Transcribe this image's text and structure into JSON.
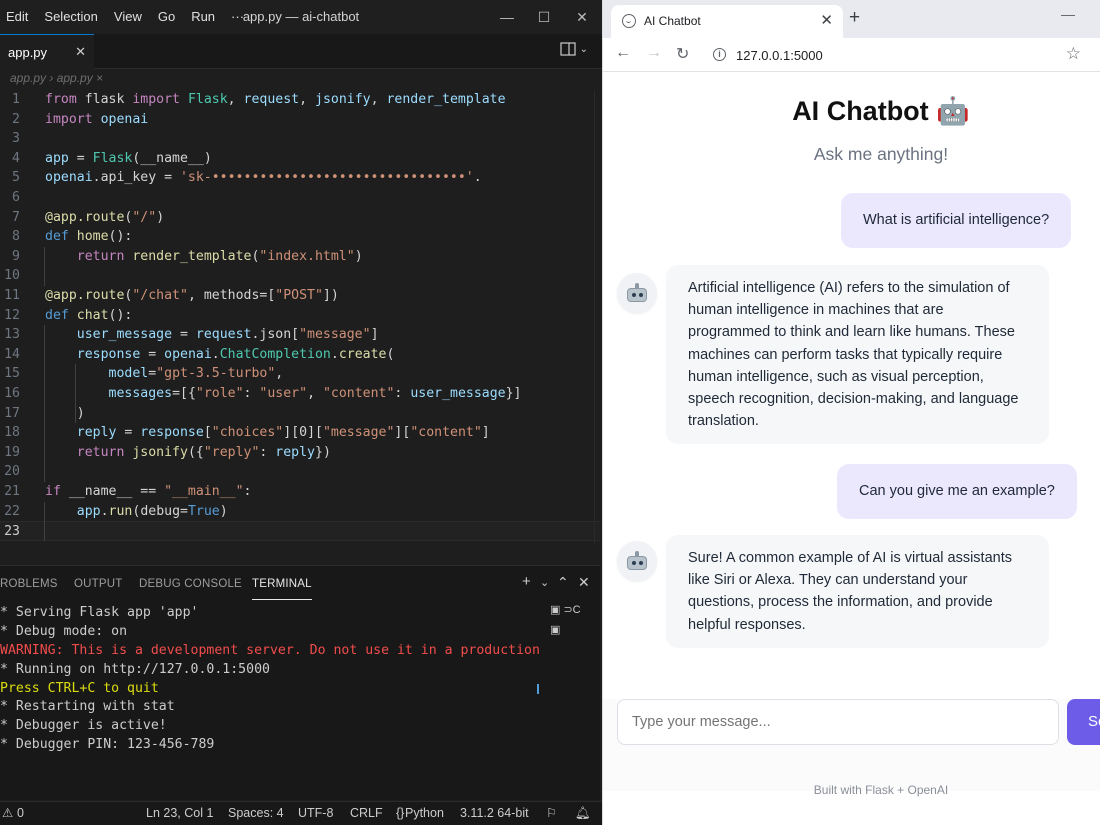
{
  "vscode": {
    "menu": [
      "Edit",
      "Selection",
      "View",
      "Go",
      "Run",
      "···"
    ],
    "window_title": "app.py — ai-chatbot",
    "tab": {
      "label": "app.py"
    },
    "breadcrumb": "app.py › app.py ×",
    "current_line": 23,
    "code_lines": [
      "from flask import Flask, request, jsonify, render_template",
      "import openai",
      "",
      "app = Flask(__name__)",
      "openai.api_key = 'sk-••••••••••••••••••••••••••••••••'.",
      "",
      "@app.route(\"/\")",
      "def home():",
      "    return render_template(\"index.html\")",
      "",
      "@app.route(\"/chat\", methods=[\"POST\"])",
      "def chat():",
      "    user_message = request.json[\"message\"]",
      "    response = openai.ChatCompletion.create(",
      "        model=\"gpt-3.5-turbo\",",
      "        messages=[{\"role\": \"user\", \"content\": user_message}]",
      "    )",
      "    reply = response[\"choices\"][0][\"message\"][\"content\"]",
      "    return jsonify({\"reply\": reply})",
      "",
      "if __name__ == \"__main__\":",
      "    app.run(debug=True)",
      ""
    ],
    "panel_tabs": [
      "PROBLEMS",
      "OUTPUT",
      "DEBUG CONSOLE",
      "TERMINAL"
    ],
    "active_panel_tab": "TERMINAL",
    "terminal_lines": [
      {
        "text": "* Serving Flask app 'app'",
        "kind": "normal"
      },
      {
        "text": "* Debug mode: on",
        "kind": "normal"
      },
      {
        "text": "WARNING: This is a development server. Do not use it in a production",
        "kind": "warn"
      },
      {
        "text": "* Running on http://127.0.0.1:5000",
        "kind": "normal"
      },
      {
        "text": "Press CTRL+C to quit",
        "kind": "yellow"
      },
      {
        "text": "* Restarting with stat",
        "kind": "normal"
      },
      {
        "text": "* Debugger is active!",
        "kind": "normal"
      },
      {
        "text": "* Debugger PIN: 123-456-789",
        "kind": "normal"
      }
    ],
    "status": {
      "errors": "0",
      "position": "Ln 23, Col 1",
      "spaces": "Spaces: 4",
      "encoding": "UTF-8",
      "eol": "CRLF",
      "language": "Python",
      "interpreter": "3.11.2 64-bit"
    }
  },
  "browser": {
    "tab_title": "AI Chatbot",
    "url": "127.0.0.1:5000",
    "page": {
      "title": "AI Chatbot 🤖",
      "subtitle": "Ask me anything!",
      "messages": [
        {
          "role": "user",
          "text": "What is artificial intelligence?"
        },
        {
          "role": "bot",
          "text": "Artificial intelligence (AI) refers to the simulation of human intelligence in machines that are programmed to think and learn like humans. These machines can perform tasks that typically require human intelligence, such as visual perception, speech recognition, decision-making, and language translation."
        },
        {
          "role": "user",
          "text": "Can you give me an example?"
        },
        {
          "role": "bot",
          "text": "Sure! A common example of AI is virtual assistants like Siri or Alexa. They can understand your questions, process the information, and provide helpful responses."
        }
      ],
      "input_placeholder": "Type your message...",
      "send_label": "Send",
      "footer": "Built with Flask + OpenAI"
    }
  },
  "colors": {
    "vscode_bg": "#1e1e1e",
    "keyword": "#c586c0",
    "string": "#ce9178",
    "function": "#dcdcaa",
    "user_bubble": "#ebe7fd",
    "bot_bubble": "#f6f7f9",
    "send_button": "#6c5ce7",
    "terminal_warning": "#f14c4c"
  },
  "icons": [
    "split-editor-icon",
    "close-icon",
    "plus-icon",
    "chevron-down-icon",
    "maximize-icon",
    "back-icon",
    "forward-icon",
    "reload-icon",
    "info-icon",
    "star-icon",
    "robot-icon",
    "bell-icon",
    "error-icon"
  ]
}
